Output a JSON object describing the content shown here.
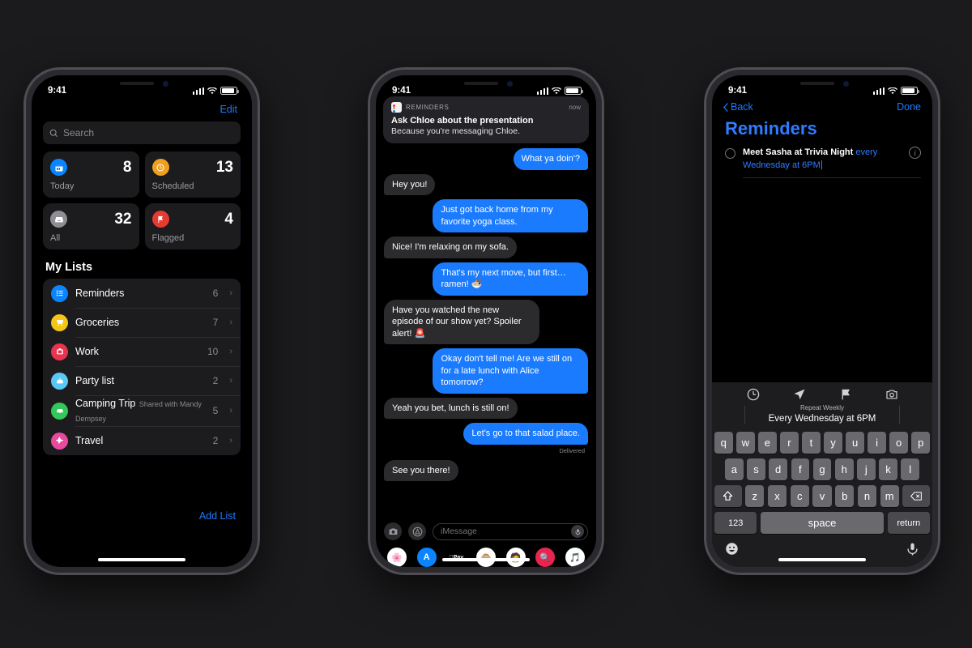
{
  "background_color": "#1b1b1d",
  "accent_blue": "#1a7bff",
  "statusbar": {
    "time": "9:41"
  },
  "phone1": {
    "edit_label": "Edit",
    "search_placeholder": "Search",
    "smart_lists": [
      {
        "name": "Today",
        "count": "8",
        "color": "#0a84ff",
        "icon": "calendar-icon"
      },
      {
        "name": "Scheduled",
        "count": "13",
        "color": "#f0a020",
        "icon": "clock-icon"
      },
      {
        "name": "All",
        "count": "32",
        "color": "#8e8e93",
        "icon": "inbox-icon"
      },
      {
        "name": "Flagged",
        "count": "4",
        "color": "#e63b30",
        "icon": "flag-icon"
      }
    ],
    "my_lists_heading": "My Lists",
    "lists": [
      {
        "name": "Reminders",
        "subtitle": "",
        "count": "6",
        "color": "#0a84ff",
        "icon": "list-icon"
      },
      {
        "name": "Groceries",
        "subtitle": "",
        "count": "7",
        "color": "#f5c518",
        "icon": "cart-icon"
      },
      {
        "name": "Work",
        "subtitle": "",
        "count": "10",
        "color": "#e8344e",
        "icon": "briefcase-icon"
      },
      {
        "name": "Party list",
        "subtitle": "",
        "count": "2",
        "color": "#5ac8f5",
        "icon": "cake-icon"
      },
      {
        "name": "Camping Trip",
        "subtitle": "Shared with Mandy Dempsey",
        "count": "5",
        "color": "#34c759",
        "icon": "car-icon"
      },
      {
        "name": "Travel",
        "subtitle": "",
        "count": "2",
        "color": "#e84a9e",
        "icon": "airplane-icon"
      }
    ],
    "add_list_label": "Add List",
    "chevron": "›"
  },
  "phone2": {
    "notification": {
      "app_name": "REMINDERS",
      "time": "now",
      "title": "Ask Chloe about the presentation",
      "subtitle": "Because you're messaging Chloe."
    },
    "messages": [
      {
        "from": "me",
        "text": "What ya doin'?"
      },
      {
        "from": "them",
        "text": "Hey you!"
      },
      {
        "from": "me",
        "text": "Just got back home from my favorite yoga class."
      },
      {
        "from": "them",
        "text": "Nice! I'm relaxing on my sofa."
      },
      {
        "from": "me",
        "text": "That's my next move, but first…ramen! 🍜"
      },
      {
        "from": "them",
        "text": "Have you watched the new episode of our show yet? Spoiler alert! 🚨"
      },
      {
        "from": "me",
        "text": "Okay don't tell me! Are we still on for a late lunch with Alice tomorrow?"
      },
      {
        "from": "them",
        "text": "Yeah you bet, lunch is still on!"
      },
      {
        "from": "me",
        "text": "Let's go to that salad place."
      },
      {
        "from": "them",
        "text": "See you there!"
      }
    ],
    "delivered_label": "Delivered",
    "input_placeholder": "iMessage",
    "app_drawer": [
      {
        "name": "photos-app",
        "glyph": "🌸",
        "bg": "#ffffff"
      },
      {
        "name": "app-store-app",
        "glyph": "A",
        "bg": "#0a84ff"
      },
      {
        "name": "apple-pay-app",
        "glyph": "Pay",
        "bg": "#000000"
      },
      {
        "name": "animoji-app",
        "glyph": "🐵",
        "bg": "#ffffff"
      },
      {
        "name": "memoji-app",
        "glyph": "🧑",
        "bg": "#ffffff"
      },
      {
        "name": "images-app",
        "glyph": "🔍",
        "bg": "#e8254f"
      },
      {
        "name": "music-app",
        "glyph": "🎵",
        "bg": "#ffffff"
      }
    ]
  },
  "phone3": {
    "back_label": "Back",
    "done_label": "Done",
    "title": "Reminders",
    "reminder": {
      "text_bold": "Meet Sasha at Trivia Night",
      "text_blue": "every Wednesday at 6PM"
    },
    "quickbar_icons": [
      "clock-icon",
      "location-icon",
      "flag-icon",
      "camera-icon"
    ],
    "repeat_label": "Repeat Weekly",
    "repeat_value": "Every Wednesday at 6PM",
    "keyboard": {
      "row1": [
        "q",
        "w",
        "e",
        "r",
        "t",
        "y",
        "u",
        "i",
        "o",
        "p"
      ],
      "row2": [
        "a",
        "s",
        "d",
        "f",
        "g",
        "h",
        "j",
        "k",
        "l"
      ],
      "row3": [
        "z",
        "x",
        "c",
        "v",
        "b",
        "n",
        "m"
      ],
      "shift": "shift-icon",
      "backspace": "backspace-icon",
      "numbers_label": "123",
      "space_label": "space",
      "return_label": "return",
      "emoji": "emoji-icon",
      "mic": "microphone-icon"
    }
  }
}
